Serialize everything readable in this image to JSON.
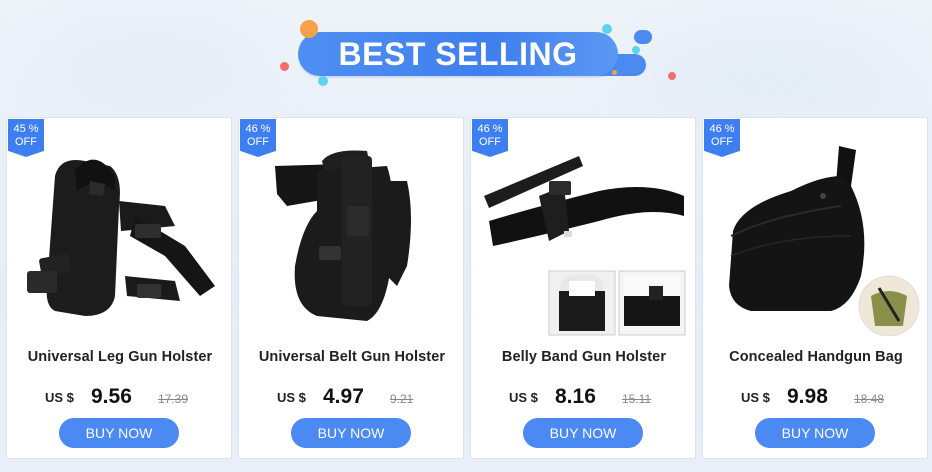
{
  "banner": {
    "title": "BEST SELLING"
  },
  "currency": "US $",
  "buy_label": "BUY NOW",
  "colors": {
    "accent": "#4a8af2",
    "badge": "#3d7ff0"
  },
  "products": [
    {
      "discount": "45 %",
      "off": "OFF",
      "title": "Universal Leg Gun Holster",
      "price": "9.56",
      "old_price": "17.39"
    },
    {
      "discount": "46 %",
      "off": "OFF",
      "title": "Universal Belt Gun Holster",
      "price": "4.97",
      "old_price": "9.21"
    },
    {
      "discount": "46 %",
      "off": "OFF",
      "title": "Belly Band Gun Holster",
      "price": "8.16",
      "old_price": "15.11"
    },
    {
      "discount": "46 %",
      "off": "OFF",
      "title": "Concealed Handgun Bag",
      "price": "9.98",
      "old_price": "18.48"
    }
  ]
}
